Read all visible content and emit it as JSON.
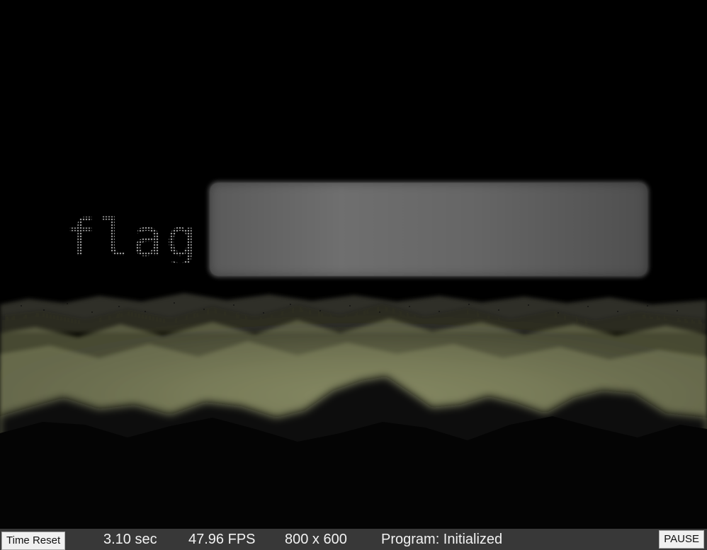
{
  "scene": {
    "flag_word": "flag",
    "colors": {
      "background": "#000000",
      "fog_light": "#8a8f66",
      "mountain_dark": "#0a0a0a",
      "panel": "#666666",
      "statusbar": "#383838"
    }
  },
  "statusbar": {
    "time_reset_label": "Time Reset",
    "time": "3.10 sec",
    "fps": "47.96 FPS",
    "resolution": "800 x 600",
    "program": "Program: Initialized",
    "pause_label": "PAUSE"
  }
}
